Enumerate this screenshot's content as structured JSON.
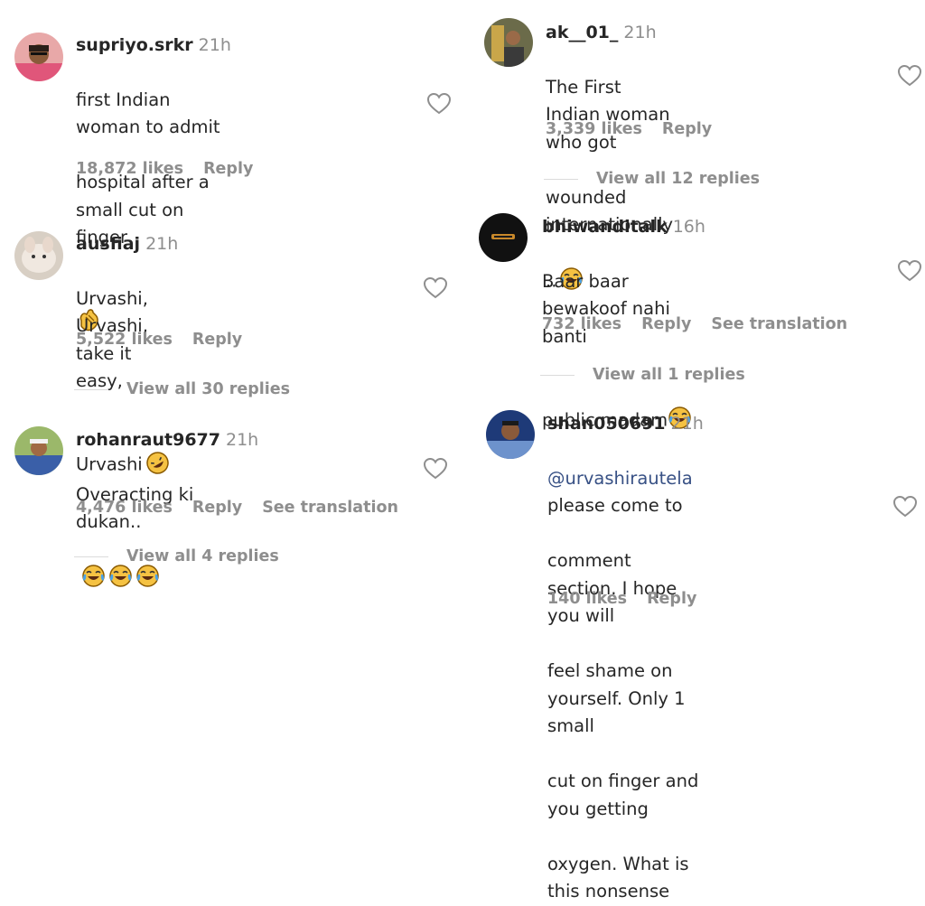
{
  "left_column": [
    {
      "username": "supriyo.srkr",
      "time": "21h",
      "text_lines": [
        "first Indian woman to admit",
        "hospital after a small cut on finger"
      ],
      "emoji": "clapping-hands-emoji",
      "likes": "18,872 likes",
      "reply": "Reply"
    },
    {
      "username": "ausfiaj",
      "time": "21h",
      "text_lines": [
        "Urvashi, Urvashi, take it easy,",
        "Urvashi"
      ],
      "emoji": "rolling-laughing-emoji",
      "likes": "5,522 likes",
      "reply": "Reply",
      "view_replies": "View all 30 replies"
    },
    {
      "username": "rohanraut9677",
      "time": "21h",
      "text_lines": [
        "Overacting ki dukan.."
      ],
      "emoji": "tears-of-joy-emoji x3",
      "likes": "4,476 likes",
      "reply": "Reply",
      "translation": "See translation",
      "view_replies": "View all 4 replies"
    }
  ],
  "right_column": [
    {
      "username": "ak__01_",
      "time": "21h",
      "text_lines": [
        "The First Indian woman who got",
        "wounded internationally .."
      ],
      "emoji": "tears-of-joy-emoji",
      "likes": "3,339 likes",
      "reply": "Reply",
      "view_replies": "View all 12 replies"
    },
    {
      "username": "bhiwanditalk",
      "time": "16h",
      "text_lines": [
        "Baar baar bewakoof nahi banti",
        "public madam"
      ],
      "emoji": "tears-of-joy-emoji",
      "likes": "732 likes",
      "reply": "Reply",
      "translation": "See translation",
      "view_replies": "View all 1 replies"
    },
    {
      "username": "shan050691",
      "time": "21h",
      "mention": "@urvashirautela",
      "text_first_rest": " please come to",
      "text_lines": [
        "comment section. I hope you will",
        "feel shame on yourself. Only 1 small",
        "cut on finger and you getting",
        "oxygen. What is this nonsense"
      ],
      "likes": "140 likes",
      "reply": "Reply"
    }
  ],
  "icons": {
    "like": "heart-outline-icon"
  },
  "colors": {
    "text": "#262626",
    "muted": "#8e8e8e",
    "mention": "#385185",
    "divider": "#dbdbdb"
  }
}
